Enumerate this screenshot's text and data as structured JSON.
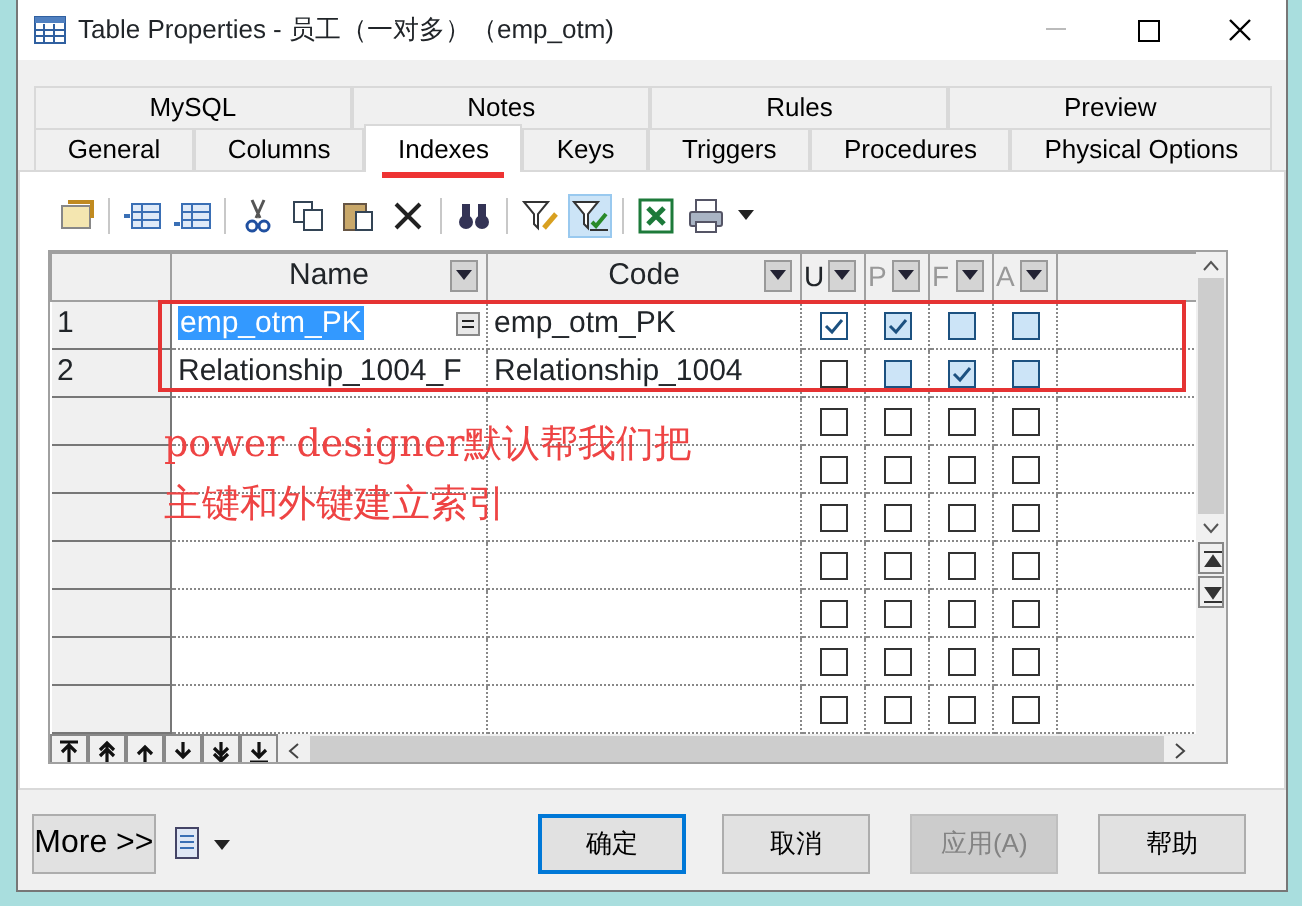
{
  "window": {
    "title": "Table Properties - 员工（一对多）（emp_otm)"
  },
  "tabs": [
    [
      {
        "label": "MySQL",
        "selected": false
      },
      {
        "label": "Notes",
        "selected": false
      },
      {
        "label": "Rules",
        "selected": false
      },
      {
        "label": "Preview",
        "selected": false
      }
    ],
    [
      {
        "label": "General",
        "selected": false
      },
      {
        "label": "Columns",
        "selected": false
      },
      {
        "label": "Indexes",
        "selected": true
      },
      {
        "label": "Keys",
        "selected": false
      },
      {
        "label": "Triggers",
        "selected": false
      },
      {
        "label": "Procedures",
        "selected": false
      },
      {
        "label": "Physical Options",
        "selected": false
      }
    ]
  ],
  "toolbar": {
    "filter_toggle": {
      "on": true
    }
  },
  "grid": {
    "columns": [
      {
        "label": "Name",
        "disabled": false
      },
      {
        "label": "Code",
        "disabled": false
      },
      {
        "label": "U",
        "disabled": false
      },
      {
        "label": "P",
        "disabled": true
      },
      {
        "label": "F",
        "disabled": true
      },
      {
        "label": "A",
        "disabled": true
      }
    ],
    "rows": [
      {
        "number": "1",
        "name": "emp_otm_PK",
        "code": "emp_otm_PK",
        "selected": true,
        "checks": [
          {
            "checked": true,
            "disabled": false
          },
          {
            "checked": true,
            "disabled": true
          },
          {
            "checked": false,
            "disabled": true
          },
          {
            "checked": false,
            "disabled": true
          }
        ]
      },
      {
        "number": "2",
        "name": "Relationship_1004_F",
        "code": "Relationship_1004",
        "selected": false,
        "checks": [
          {
            "checked": false,
            "disabled": false
          },
          {
            "checked": false,
            "disabled": true
          },
          {
            "checked": true,
            "disabled": true
          },
          {
            "checked": false,
            "disabled": true
          }
        ]
      },
      {
        "checks": [
          {
            "checked": false,
            "disabled": false
          },
          {
            "checked": false,
            "disabled": false
          },
          {
            "checked": false,
            "disabled": false
          },
          {
            "checked": false,
            "disabled": false
          }
        ]
      },
      {
        "checks": [
          {
            "checked": false,
            "disabled": false
          },
          {
            "checked": false,
            "disabled": false
          },
          {
            "checked": false,
            "disabled": false
          },
          {
            "checked": false,
            "disabled": false
          }
        ]
      },
      {
        "checks": [
          {
            "checked": false,
            "disabled": false
          },
          {
            "checked": false,
            "disabled": false
          },
          {
            "checked": false,
            "disabled": false
          },
          {
            "checked": false,
            "disabled": false
          }
        ]
      },
      {
        "checks": [
          {
            "checked": false,
            "disabled": false
          },
          {
            "checked": false,
            "disabled": false
          },
          {
            "checked": false,
            "disabled": false
          },
          {
            "checked": false,
            "disabled": false
          }
        ]
      },
      {
        "checks": [
          {
            "checked": false,
            "disabled": false
          },
          {
            "checked": false,
            "disabled": false
          },
          {
            "checked": false,
            "disabled": false
          },
          {
            "checked": false,
            "disabled": false
          }
        ]
      },
      {
        "checks": [
          {
            "checked": false,
            "disabled": false
          },
          {
            "checked": false,
            "disabled": false
          },
          {
            "checked": false,
            "disabled": false
          },
          {
            "checked": false,
            "disabled": false
          }
        ]
      },
      {
        "checks": [
          {
            "checked": false,
            "disabled": false
          },
          {
            "checked": false,
            "disabled": false
          },
          {
            "checked": false,
            "disabled": false
          },
          {
            "checked": false,
            "disabled": false
          }
        ]
      }
    ]
  },
  "annotation": {
    "lines": [
      "power designer默认帮我们把",
      "主键和外键建立索引"
    ]
  },
  "buttons": [
    {
      "label": "More >>",
      "kind": "more",
      "disabled": false
    },
    {
      "label": "确定",
      "kind": "default",
      "disabled": false
    },
    {
      "label": "取消",
      "kind": "normal",
      "disabled": false
    },
    {
      "label": "应用(A)",
      "kind": "normal",
      "disabled": true
    },
    {
      "label": "帮助",
      "kind": "normal",
      "disabled": false
    }
  ]
}
